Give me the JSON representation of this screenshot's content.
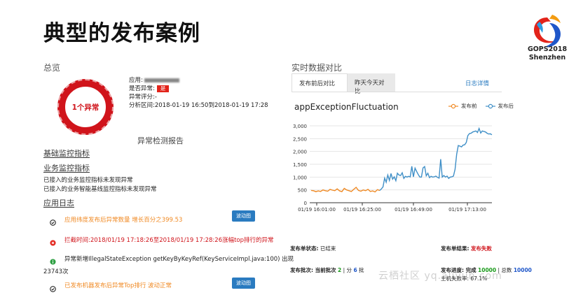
{
  "slide": {
    "title": "典型的发布案例"
  },
  "logo": {
    "line1": "GOPS2018",
    "line2": "Shenzhen"
  },
  "overview": {
    "section_label": "总览",
    "ring_label": "1个异常",
    "app_label": "应用:",
    "abnormal_label": "是否异常:",
    "abnormal_badge": "是",
    "score_label": "异常评分:-",
    "range_label": "分析区间:2018-01-19 16:50到2018-01-19 17:28"
  },
  "report": {
    "title": "异常检测报告",
    "basic_metrics": "基础监控指标",
    "business_metrics": "业务监控指标",
    "line1": "已接入的业务监控指标未发现异常",
    "line2": "已接入的业务智能基线监控指标未发现异常",
    "app_logs": "应用日志",
    "items": [
      {
        "text": "应用纬度发布后异常数量 增长百分之399.53",
        "button": "波动图"
      },
      {
        "text": "拦截时间:2018/01/19 17:18:26至2018/01/19 17:28:26涨幅top排行的异常"
      },
      {
        "text": "异常新增IllegalStateException getKeyByKeyRef(KeyServiceImpl.java:100) 出现",
        "cont": "23743次"
      },
      {
        "text": "已发布机器发布后异常Top排行 波动正常",
        "button": "波动图"
      }
    ]
  },
  "realtime": {
    "section_label": "实时数据对比",
    "tabs": [
      "发布前后对比",
      "昨天今天对比"
    ],
    "log_link": "日志详情"
  },
  "chart_data": {
    "type": "line",
    "title": "appExceptionFluctuation",
    "series": [
      {
        "name": "发布前",
        "color": "#f08a24",
        "values": [
          480,
          470,
          430,
          460,
          440,
          500,
          470,
          450,
          520,
          490,
          470,
          540,
          460,
          430,
          560,
          500,
          470,
          440,
          520,
          600,
          480,
          450,
          500,
          470,
          520,
          440,
          460,
          420,
          510,
          480
        ]
      },
      {
        "name": "发布后",
        "color": "#3f8fc7",
        "values": [
          480,
          540,
          620,
          960,
          800,
          1080,
          870,
          1140,
          920,
          1010,
          860,
          1150,
          1080,
          1060,
          1170,
          950,
          1030,
          1000,
          1030,
          1010,
          1420,
          1010,
          1350,
          1220,
          1100,
          1000,
          1000,
          1360,
          1410,
          1050,
          1150,
          980,
          1030,
          1000,
          1010,
          1040,
          990,
          960,
          1700,
          1000,
          1060,
          1000,
          1040,
          950,
          1000,
          1010,
          1040,
          1300,
          1890,
          2230,
          2210,
          2180,
          2250,
          2260,
          2350,
          2620,
          2700,
          2710,
          2760,
          2780,
          2800,
          2740,
          2900,
          2720,
          2800,
          2780,
          2760,
          2710,
          2680,
          2690,
          2650
        ]
      }
    ],
    "yticks": [
      "3,000",
      "2,500",
      "2,000",
      "1,500",
      "1,000",
      "500",
      "0"
    ],
    "xticks": [
      "01/19 16:01:00",
      "01/19 16:25:00",
      "01/19 16:49:00",
      "01/19 17:13:00"
    ],
    "ylim": [
      0,
      3000
    ]
  },
  "footer": {
    "status_label": "发布单状态:",
    "status_value": "已结束",
    "result_label": "发布单结果:",
    "result_value": "发布失败",
    "batch_label": "发布批次: 当前批次",
    "batch_current": "2",
    "batch_sep": "| 分",
    "batch_total": "6",
    "batch_unit": "批",
    "progress_label": "发布进度: 完成",
    "progress_done": "10000",
    "progress_sep": "| 总数",
    "progress_total": "10000",
    "fail_rate": "主机失败率: 67.1%"
  },
  "watermark": "云栖社区 yq.aliyun.com"
}
